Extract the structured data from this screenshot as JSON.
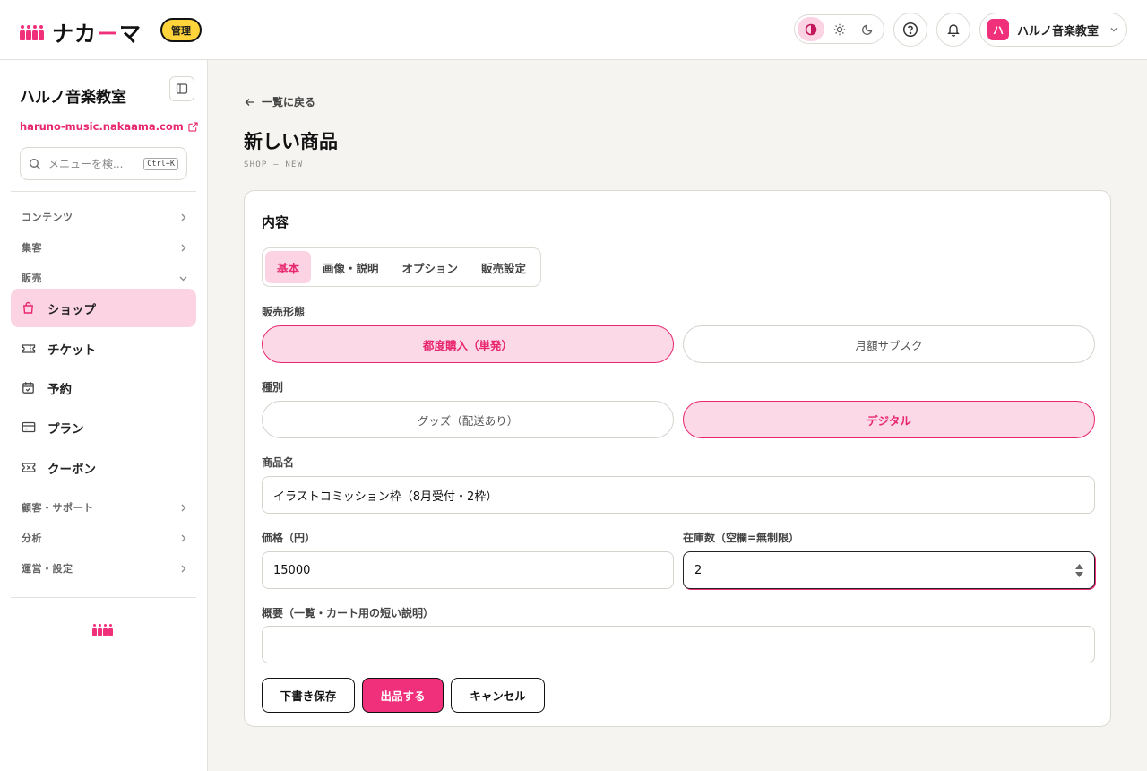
{
  "header": {
    "logo_text_a": "ナカ",
    "logo_text_b": "ー",
    "logo_text_c": "マ",
    "admin_badge": "管理",
    "theme_options": [
      "contrast-icon",
      "sun-icon",
      "moon-icon"
    ],
    "account_initial": "ハ",
    "account_name": "ハルノ音楽教室"
  },
  "sidebar": {
    "title": "ハルノ音楽教室",
    "url": "haruno-music.nakaama.com",
    "search_placeholder": "メニューを検...",
    "search_shortcut": "Ctrl+K",
    "groups": [
      {
        "label": "コンテンツ",
        "expanded": false
      },
      {
        "label": "集客",
        "expanded": false
      },
      {
        "label": "販売",
        "expanded": true
      }
    ],
    "items": [
      {
        "label": "ショップ",
        "icon": "shopping-bag-icon",
        "active": true
      },
      {
        "label": "チケット",
        "icon": "ticket-icon",
        "active": false
      },
      {
        "label": "予約",
        "icon": "calendar-check-icon",
        "active": false
      },
      {
        "label": "プラン",
        "icon": "credit-card-icon",
        "active": false
      },
      {
        "label": "クーポン",
        "icon": "coupon-icon",
        "active": false
      }
    ],
    "groups_bottom": [
      {
        "label": "顧客・サポート"
      },
      {
        "label": "分析"
      },
      {
        "label": "運営・設定"
      }
    ]
  },
  "main": {
    "back_link": "一覧に戻る",
    "title": "新しい商品",
    "subtitle": "SHOP — NEW",
    "card_title": "内容",
    "tabs": [
      {
        "label": "基本",
        "active": true
      },
      {
        "label": "画像・説明",
        "active": false
      },
      {
        "label": "オプション",
        "active": false
      },
      {
        "label": "販売設定",
        "active": false
      }
    ],
    "sale_type_label": "販売形態",
    "sale_type_options": [
      {
        "label": "都度購入（単発）",
        "selected": true
      },
      {
        "label": "月額サブスク",
        "selected": false
      }
    ],
    "kind_label": "種別",
    "kind_options": [
      {
        "label": "グッズ（配送あり）",
        "selected": false
      },
      {
        "label": "デジタル",
        "selected": true
      }
    ],
    "name_label": "商品名",
    "name_value": "イラストコミッション枠（8月受付・2枠）",
    "price_label": "価格（円）",
    "price_value": "15000",
    "stock_label": "在庫数（空欄=無制限）",
    "stock_value": "2",
    "summary_label": "概要（一覧・カート用の短い説明）",
    "summary_value": "",
    "buttons": {
      "draft": "下書き保存",
      "publish": "出品する",
      "cancel": "キャンセル"
    }
  },
  "colors": {
    "accent": "#f0307b",
    "accent_soft": "#fcd3e2",
    "badge_yellow": "#ffd43b"
  }
}
